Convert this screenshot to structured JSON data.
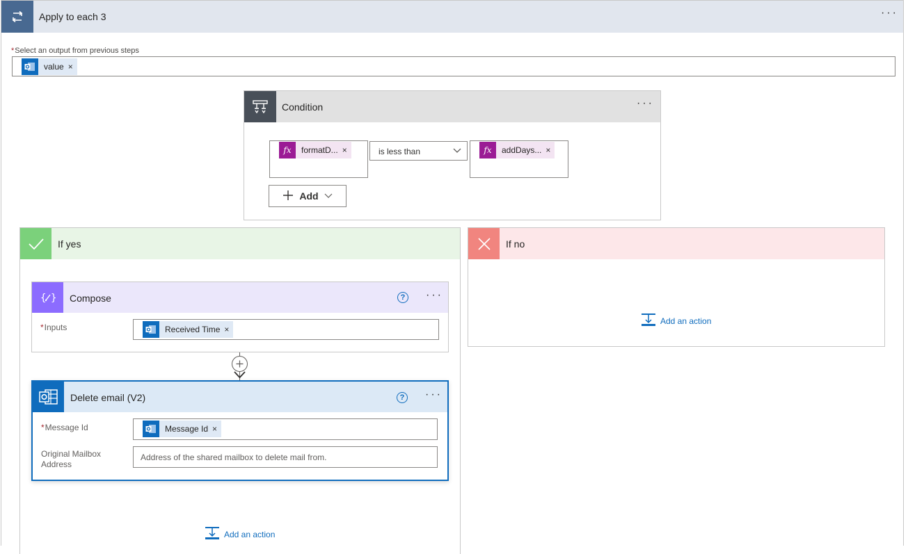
{
  "apply_each": {
    "title": "Apply to each 3",
    "more": "···",
    "select_label": "Select an output from previous steps",
    "required_mark": "*",
    "token": {
      "label": "value",
      "remove": "×"
    }
  },
  "condition": {
    "title": "Condition",
    "more": "···",
    "left_token": {
      "fx": "fx",
      "label": "formatD...",
      "remove": "×"
    },
    "operator": "is less than",
    "right_token": {
      "fx": "fx",
      "label": "addDays...",
      "remove": "×"
    },
    "add_label": "Add"
  },
  "if_yes": {
    "title": "If yes",
    "compose": {
      "title": "Compose",
      "help": "?",
      "more": "···",
      "inputs_label": "Inputs",
      "required_mark": "*",
      "token": {
        "label": "Received Time",
        "remove": "×"
      }
    },
    "delete_email": {
      "title": "Delete email (V2)",
      "help": "?",
      "more": "···",
      "message_id_label": "Message Id",
      "required_mark": "*",
      "message_id_token": {
        "label": "Message Id",
        "remove": "×"
      },
      "mailbox_label": "Original Mailbox Address",
      "mailbox_placeholder": "Address of the shared mailbox to delete mail from."
    },
    "add_action": "Add an action"
  },
  "if_no": {
    "title": "If no",
    "add_action": "Add an action"
  },
  "colors": {
    "apply_header": "#e1e6ee",
    "apply_icon": "#486991",
    "condition_icon": "#484f58",
    "yes_header": "#e8f5e6",
    "yes_icon": "#7bd17b",
    "no_header": "#fde7e9",
    "no_icon": "#f1857f",
    "compose_icon": "#8c6cff",
    "outlook_blue": "#0f6cbd",
    "fx_purple": "#9b1b95"
  }
}
